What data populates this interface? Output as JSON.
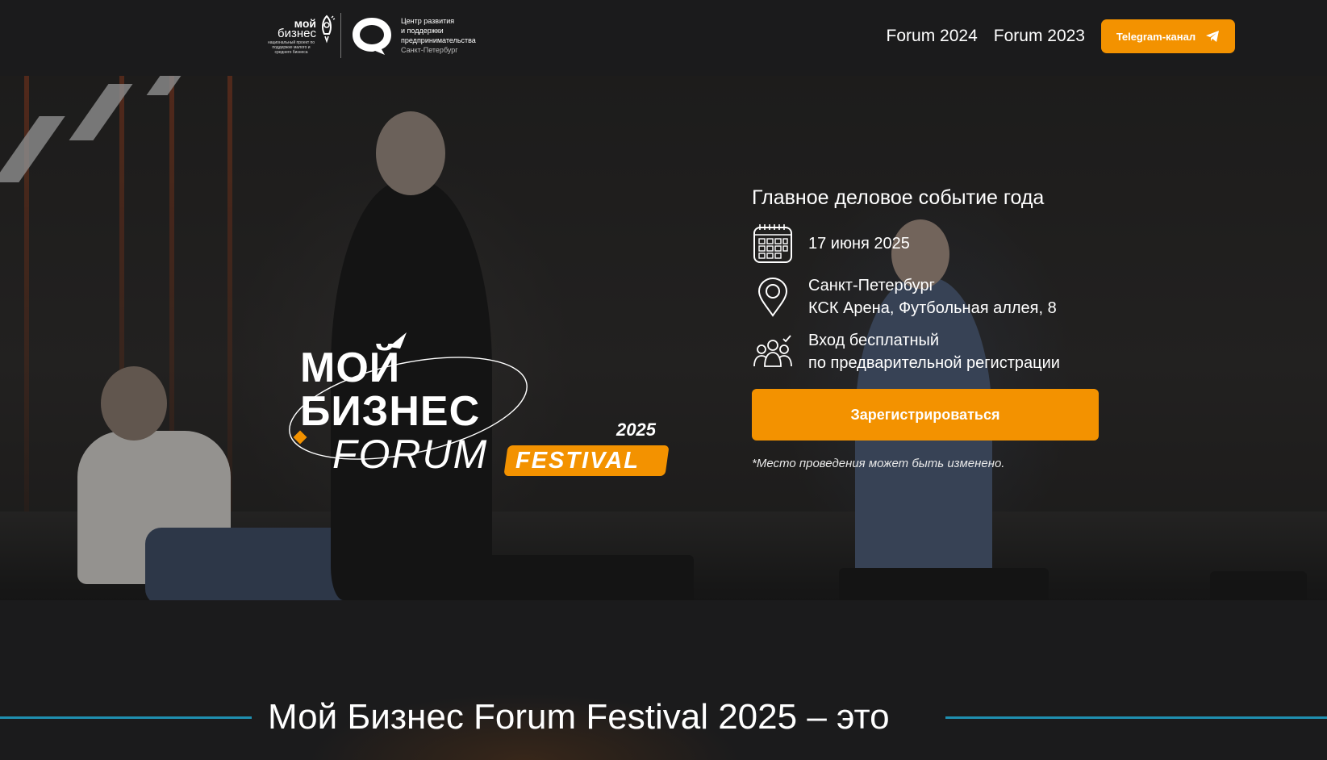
{
  "header": {
    "logo_mb": {
      "word1": "мой",
      "word2": "бизнес",
      "tagline": "национальный проект по поддержке малого и среднего бизнеса"
    },
    "logo_center": {
      "line1": "Центр развития",
      "line2": "и поддержки",
      "line3": "предпринимательства",
      "line4": "Санкт-Петербург"
    },
    "nav": [
      "Forum 2024",
      "Forum 2023"
    ],
    "telegram_label": "Telegram-канал"
  },
  "hero": {
    "logo": {
      "line1": "МОЙ",
      "line2": "БИЗНЕС",
      "forum": "FORUM",
      "year": "2025",
      "festival": "FESTIVAL"
    },
    "heading": "Главное деловое событие года",
    "date": "17 июня 2025",
    "location_city": "Санкт-Петербург",
    "location_address": "КСК Арена, Футбольная аллея, 8",
    "entry_line1": "Вход бесплатный",
    "entry_line2": "по предварительной регистрации",
    "register_label": "Зарегистрироваться",
    "note": "*Место проведения может быть изменено."
  },
  "section": {
    "title": "Мой Бизнес Forum Festival 2025 – это"
  },
  "colors": {
    "accent": "#f39200",
    "rule": "#1f8fb0",
    "background": "#1b1b1c"
  },
  "icons": {
    "calendar": "calendar-icon",
    "location": "map-pin-icon",
    "people": "people-group-icon",
    "telegram": "telegram-icon",
    "rocket": "rocket-icon"
  }
}
